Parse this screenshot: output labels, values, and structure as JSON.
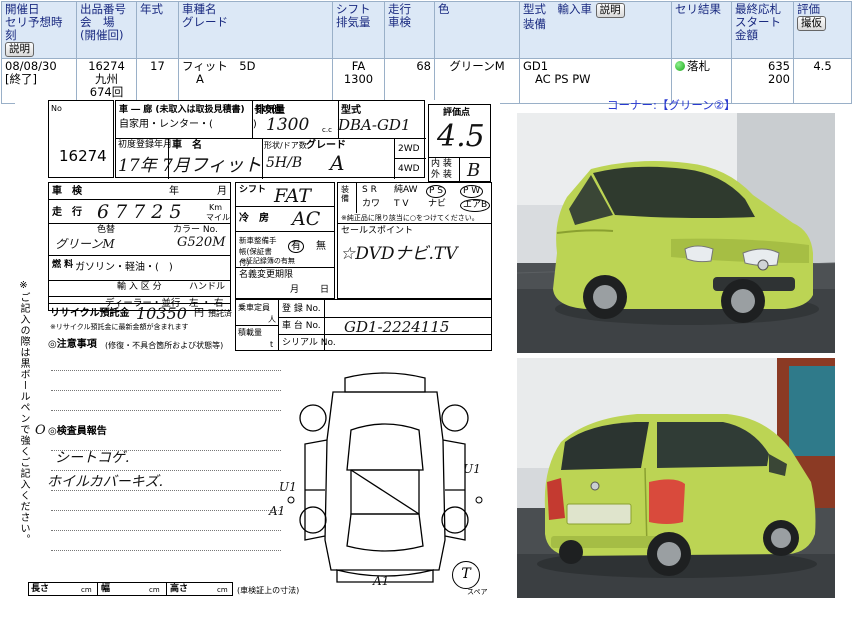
{
  "header": {
    "col_date": "開催日\nセリ予想時刻",
    "col_lot": "出品番号\n会　場\n(開催回)",
    "col_year": "年式",
    "col_model": "車種名\nグレード",
    "col_shift": "シフト\n排気量",
    "col_mileage": "走行\n車検",
    "col_color": "色",
    "col_type": "型式　輸入車",
    "col_type2": "装備",
    "col_result": "セリ結果",
    "col_price": "最終応札\nスタート金額",
    "col_score": "評価",
    "explain_btn": "説明",
    "explain_btn2": "説明",
    "explain_btn3": "説明",
    "score_btn": "撮仮"
  },
  "row": {
    "date": "08/08/30",
    "status": "[終了]",
    "lot_no": "16274",
    "venue": "九州",
    "session": "674回",
    "year": "17",
    "model": "フィット　5D",
    "grade": "A",
    "shift": "FA",
    "displacement": "1300",
    "mileage": "68",
    "color": "グリーンM",
    "model_code": "GD1",
    "equipment": "AC PS PW",
    "result": "落札",
    "final_bid": "635",
    "start_price": "200",
    "score": "4.5"
  },
  "corner": "コーナー:【グリーン②】",
  "sheet": {
    "no_label": "No",
    "lot_no": "16274",
    "reg_label": "車 ― 廊 (未取入は取扱見積書)　その他",
    "reg_options": "自家用・レンター・(　　　　)",
    "displacement_label": "排気量",
    "displacement": "1300",
    "cc": "c.c",
    "type_label": "型式",
    "type": "DBA-GD1",
    "score_label": "評価点",
    "score": "4.5",
    "first_reg_label": "初度登録年月",
    "first_reg": "17年 7月",
    "model_label": "車　名",
    "model": "フィット",
    "shape_label": "形状/ドア数",
    "shape": "5H/B",
    "grade_label": "グレード",
    "grade": "A",
    "drive_2wd": "2WD",
    "drive_4wd": "4WD",
    "interior_label": "内 装",
    "interior": "B",
    "exterior_label": "外 装",
    "inspection_label": "車　検",
    "year_label": "年",
    "month_label": "月",
    "mileage_label": "走　行",
    "mileage": "67725",
    "km_label": "Km",
    "mile_label": "マイル",
    "exterior_color_label": "色替",
    "color_label": "カラー No.",
    "color_value": "グリーンM",
    "color_no": "G520M",
    "fuel_label": "燃 料",
    "fuel": "ガソリン・軽油・(　)",
    "import_label": "輸 入 区 分",
    "handle_label": "ハンドル",
    "import_value": "ディーラー・並行",
    "handle_value": "左 ・ 右",
    "recycle_label": "リサイクル預託金",
    "recycle_value": "10350",
    "recycle_unit": "円",
    "recycle_status": "預託済",
    "recycle_note": "※リサイクル預託金に最新金額が含まれます",
    "shift_label": "シフト",
    "shift": "FAT",
    "ac_label": "冷　房",
    "ac": "AC",
    "warranty_label": "新車整備手帳(保証書付)",
    "warranty_yes": "有",
    "warranty_no": "無",
    "warranty_note": "※証記録簿の有無",
    "name_change_label": "名義変更期限",
    "name_change_month": "月",
    "name_change_day": "日",
    "capacity_label": "乗車定員",
    "capacity_unit": "人",
    "load_label": "積載量",
    "load_unit": "t",
    "reg_no_label": "登 録 No.",
    "chassis_label": "車 台 No.",
    "chassis": "GD1-2224115",
    "serial_label": "シリアル No.",
    "equipment_codes": "装 備",
    "eq1": "S R",
    "eq2": "純AW",
    "eq3": "P S",
    "eq4": "P W",
    "eq5": "カワ",
    "eq6": "T V",
    "eq7": "ナビ",
    "eq8": "エアB",
    "eq_note": "※純正品に限り該当に○をつけてください。",
    "sales_point_label": "セールスポイント",
    "sales_point": "☆DVDナビ.TV",
    "notes_label": "◎注意事項",
    "notes_sub": "(修復・不具合箇所および状態等)",
    "inspector_label": "◎検査員報告",
    "inspector_line1": "シートコゲ.",
    "inspector_line2": "ホイルカバーキズ.",
    "side_text": "※ご記入の際は黒ボールペンで強くご記入ください。",
    "length_label": "長さ",
    "width_label": "幅",
    "height_label": "高さ",
    "cm": "cm",
    "dim_note": "(車検証上の寸法)",
    "spare_label": "スペア",
    "spare_mark": "T",
    "mark_a1_left": "A1",
    "mark_a1_bottom": "A1",
    "mark_u1_left": "U1",
    "mark_u1_right": "U1",
    "mark_o": "O"
  },
  "photos": {
    "front_alt": "green compact hatchback front three-quarter view",
    "rear_alt": "green compact hatchback rear three-quarter view",
    "car_color": "#bcd454",
    "car_dark": "#8aa030"
  }
}
